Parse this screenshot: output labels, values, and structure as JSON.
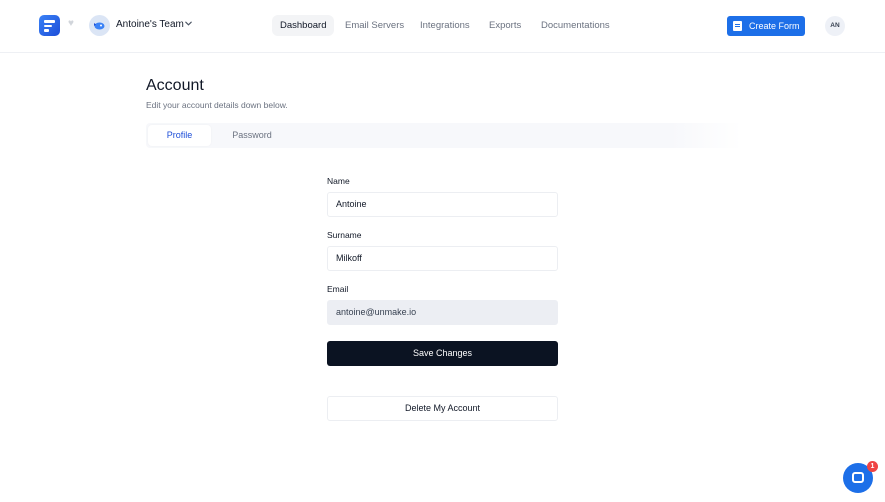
{
  "header": {
    "team_name": "Antoine's Team",
    "nav": [
      "Dashboard",
      "Email Servers",
      "Integrations",
      "Exports",
      "Documentations"
    ],
    "create_form_label": "Create Form",
    "user_initials": "AN"
  },
  "page": {
    "title": "Account",
    "subtitle": "Edit your account details down below."
  },
  "tabs": {
    "profile": "Profile",
    "password": "Password"
  },
  "form": {
    "name_label": "Name",
    "name_value": "Antoine",
    "surname_label": "Surname",
    "surname_value": "Milkoff",
    "email_label": "Email",
    "email_value": "antoine@unmake.io",
    "save_label": "Save Changes",
    "delete_label": "Delete My Account"
  },
  "chat": {
    "badge_count": "1"
  },
  "colors": {
    "accent": "#1d6fe8",
    "primary_button": "#0b1322",
    "badge": "#ef4444"
  },
  "icons": {
    "logo": "forms-logo-icon",
    "heart": "heart-icon",
    "team": "team-avatar-icon",
    "chevron": "chevron-down-icon",
    "create": "form-doc-icon",
    "chat": "chat-bubble-icon"
  }
}
